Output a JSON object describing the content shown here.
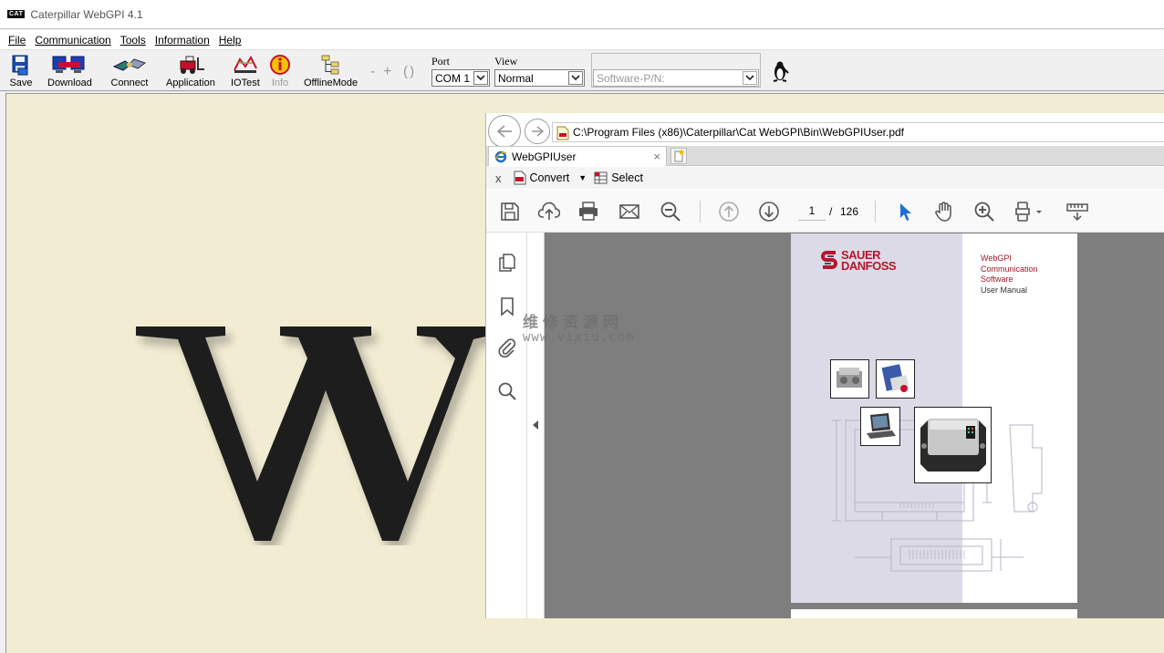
{
  "window": {
    "logo_text": "CAT",
    "title": "Caterpillar WebGPI 4.1"
  },
  "menu": [
    "File",
    "Communication",
    "Tools",
    "Information",
    "Help"
  ],
  "toolbar": {
    "save": "Save",
    "download": "Download",
    "connect": "Connect",
    "application": "Application",
    "iotest": "IOTest",
    "info": "Info",
    "offline": "OfflineMode",
    "zoom_out": "-",
    "zoom_in": "+",
    "parens": "( )",
    "port_label": "Port",
    "port_value": "COM 1",
    "view_label": "View",
    "view_value": "Normal",
    "software_placeholder": "Software-P/N:"
  },
  "browser": {
    "address": "C:\\Program Files (x86)\\Caterpillar\\Cat WebGPI\\Bin\\WebGPIUser.pdf",
    "tab_title": "WebGPIUser",
    "tab_close": "×",
    "cmd_close": "x",
    "convert": "Convert",
    "select": "Select"
  },
  "pdf": {
    "current_page": "1",
    "page_separator": "/",
    "total_pages": "126",
    "brand_line1": "SAUER",
    "brand_line2": "DANFOSS",
    "title_lines": [
      "WebGPI",
      "Communication",
      "Software",
      "User Manual"
    ]
  },
  "watermark": {
    "line1": "维修资源网",
    "line2": "www.vixiu.com"
  },
  "colors": {
    "workspace_bg": "#f2ecd2",
    "pdf_gray": "#7e7e7e",
    "page_band": "#dcdae6",
    "brand_red": "#b5172c",
    "select_blue": "#1c6fd1"
  }
}
